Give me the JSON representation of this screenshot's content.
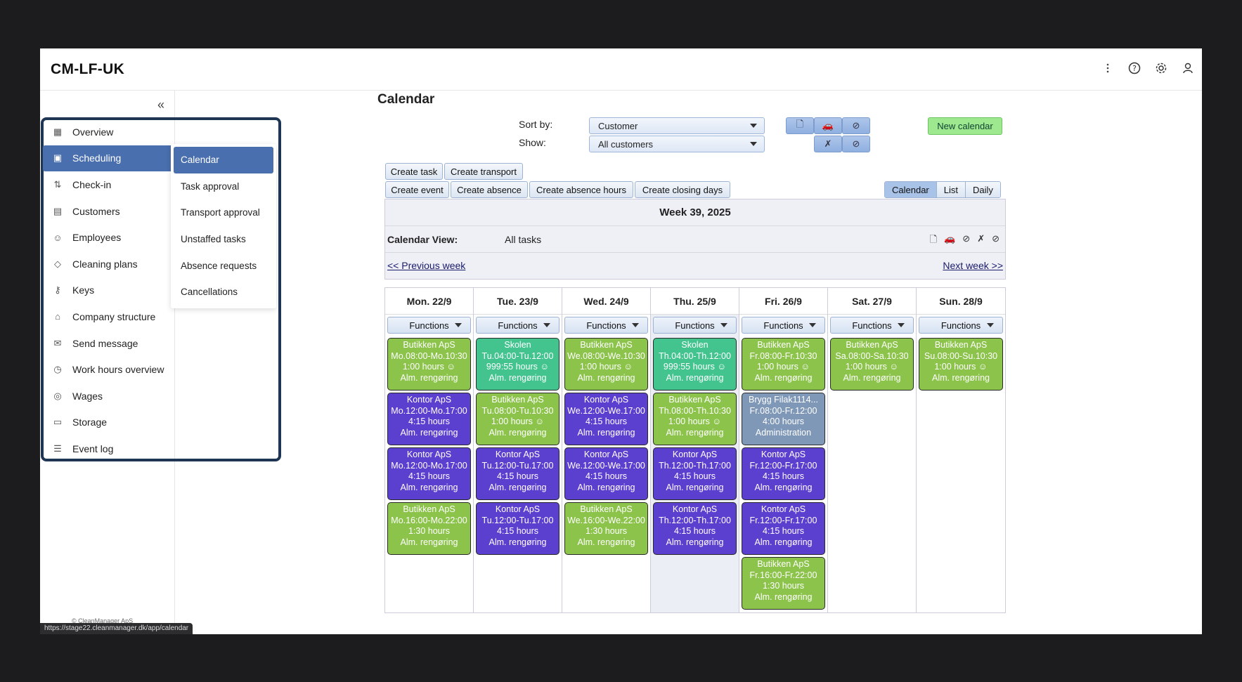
{
  "app": {
    "title": "CM-LF-UK"
  },
  "sidebar": {
    "items": [
      {
        "label": "Overview",
        "icon": "grid-icon"
      },
      {
        "label": "Scheduling",
        "icon": "calendar-icon"
      },
      {
        "label": "Check-in",
        "icon": "arrows-icon"
      },
      {
        "label": "Customers",
        "icon": "building-icon"
      },
      {
        "label": "Employees",
        "icon": "people-icon"
      },
      {
        "label": "Cleaning plans",
        "icon": "plan-icon"
      },
      {
        "label": "Keys",
        "icon": "key-icon"
      },
      {
        "label": "Company structure",
        "icon": "home-icon"
      },
      {
        "label": "Send message",
        "icon": "mail-icon"
      },
      {
        "label": "Work hours overview",
        "icon": "clock-icon"
      },
      {
        "label": "Wages",
        "icon": "coins-icon"
      },
      {
        "label": "Storage",
        "icon": "box-icon"
      },
      {
        "label": "Event log",
        "icon": "list-icon"
      }
    ],
    "submenu": [
      "Calendar",
      "Task approval",
      "Transport approval",
      "Unstaffed tasks",
      "Absence requests",
      "Cancellations"
    ],
    "copyright": "© CleanManager ApS",
    "status_url": "https://stage22.cleanmanager.dk/app/calendar"
  },
  "main": {
    "title": "Calendar",
    "sort_label": "Sort by:",
    "sort_value": "Customer",
    "show_label": "Show:",
    "show_value": "All customers",
    "new_calendar": "New calendar",
    "buttons_row1": [
      "Create task",
      "Create transport"
    ],
    "buttons_row2": [
      "Create event",
      "Create absence",
      "Create absence hours",
      "Create closing days"
    ],
    "views": [
      "Calendar",
      "List",
      "Daily"
    ],
    "week_title": "Week 39, 2025",
    "cal_view_label": "Calendar View:",
    "cal_view_value": "All tasks",
    "prev_week": "<< Previous week",
    "next_week": "Next week >>",
    "functions_label": "Functions"
  },
  "days": [
    {
      "label": "Mon. 22/9",
      "tasks": [
        {
          "c": "green",
          "l": [
            "Butikken ApS",
            "Mo.08:00-Mo.10:30",
            "1:00 hours ☺",
            "Alm. rengøring"
          ]
        },
        {
          "c": "purple",
          "l": [
            "Kontor ApS",
            "Mo.12:00-Mo.17:00",
            "4:15 hours",
            "Alm. rengøring"
          ]
        },
        {
          "c": "purple",
          "l": [
            "Kontor ApS",
            "Mo.12:00-Mo.17:00",
            "4:15 hours",
            "Alm. rengøring"
          ]
        },
        {
          "c": "green",
          "l": [
            "Butikken ApS",
            "Mo.16:00-Mo.22:00",
            "1:30 hours",
            "Alm. rengøring"
          ]
        }
      ]
    },
    {
      "label": "Tue. 23/9",
      "tasks": [
        {
          "c": "teal",
          "l": [
            "Skolen",
            "Tu.04:00-Tu.12:00",
            "999:55 hours ☺",
            "Alm. rengøring"
          ]
        },
        {
          "c": "green",
          "l": [
            "Butikken ApS",
            "Tu.08:00-Tu.10:30",
            "1:00 hours ☺",
            "Alm. rengøring"
          ]
        },
        {
          "c": "purple",
          "l": [
            "Kontor ApS",
            "Tu.12:00-Tu.17:00",
            "4:15 hours",
            "Alm. rengøring"
          ]
        },
        {
          "c": "purple",
          "l": [
            "Kontor ApS",
            "Tu.12:00-Tu.17:00",
            "4:15 hours",
            "Alm. rengøring"
          ]
        }
      ]
    },
    {
      "label": "Wed. 24/9",
      "tasks": [
        {
          "c": "green",
          "l": [
            "Butikken ApS",
            "We.08:00-We.10:30",
            "1:00 hours ☺",
            "Alm. rengøring"
          ]
        },
        {
          "c": "purple",
          "l": [
            "Kontor ApS",
            "We.12:00-We.17:00",
            "4:15 hours",
            "Alm. rengøring"
          ]
        },
        {
          "c": "purple",
          "l": [
            "Kontor ApS",
            "We.12:00-We.17:00",
            "4:15 hours",
            "Alm. rengøring"
          ]
        },
        {
          "c": "green",
          "l": [
            "Butikken ApS",
            "We.16:00-We.22:00",
            "1:30 hours",
            "Alm. rengøring"
          ]
        }
      ]
    },
    {
      "label": "Thu. 25/9",
      "today": true,
      "tasks": [
        {
          "c": "teal",
          "l": [
            "Skolen",
            "Th.04:00-Th.12:00",
            "999:55 hours ☺",
            "Alm. rengøring"
          ]
        },
        {
          "c": "green",
          "l": [
            "Butikken ApS",
            "Th.08:00-Th.10:30",
            "1:00 hours ☺",
            "Alm. rengøring"
          ]
        },
        {
          "c": "purple",
          "l": [
            "Kontor ApS",
            "Th.12:00-Th.17:00",
            "4:15 hours",
            "Alm. rengøring"
          ]
        },
        {
          "c": "purple",
          "l": [
            "Kontor ApS",
            "Th.12:00-Th.17:00",
            "4:15 hours",
            "Alm. rengøring"
          ]
        }
      ]
    },
    {
      "label": "Fri. 26/9",
      "tasks": [
        {
          "c": "green",
          "l": [
            "Butikken ApS",
            "Fr.08:00-Fr.10:30",
            "1:00 hours ☺",
            "Alm. rengøring"
          ]
        },
        {
          "c": "gray",
          "l": [
            "Brygg Filak1114...",
            "Fr.08:00-Fr.12:00",
            "4:00 hours",
            "Administration"
          ]
        },
        {
          "c": "purple",
          "l": [
            "Kontor ApS",
            "Fr.12:00-Fr.17:00",
            "4:15 hours",
            "Alm. rengøring"
          ]
        },
        {
          "c": "purple",
          "l": [
            "Kontor ApS",
            "Fr.12:00-Fr.17:00",
            "4:15 hours",
            "Alm. rengøring"
          ]
        },
        {
          "c": "green",
          "l": [
            "Butikken ApS",
            "Fr.16:00-Fr.22:00",
            "1:30 hours",
            "Alm. rengøring"
          ]
        }
      ]
    },
    {
      "label": "Sat. 27/9",
      "tasks": [
        {
          "c": "green",
          "l": [
            "Butikken ApS",
            "Sa.08:00-Sa.10:30",
            "1:00 hours ☺",
            "Alm. rengøring"
          ]
        }
      ]
    },
    {
      "label": "Sun. 28/9",
      "tasks": [
        {
          "c": "green",
          "l": [
            "Butikken ApS",
            "Su.08:00-Su.10:30",
            "1:00 hours ☺",
            "Alm. rengøring"
          ]
        }
      ]
    }
  ],
  "colors": {
    "active": "#4a6fae",
    "green": "#8cc34b",
    "teal": "#43c48f",
    "purple": "#5b3fcf",
    "gray": "#7f98b8"
  }
}
